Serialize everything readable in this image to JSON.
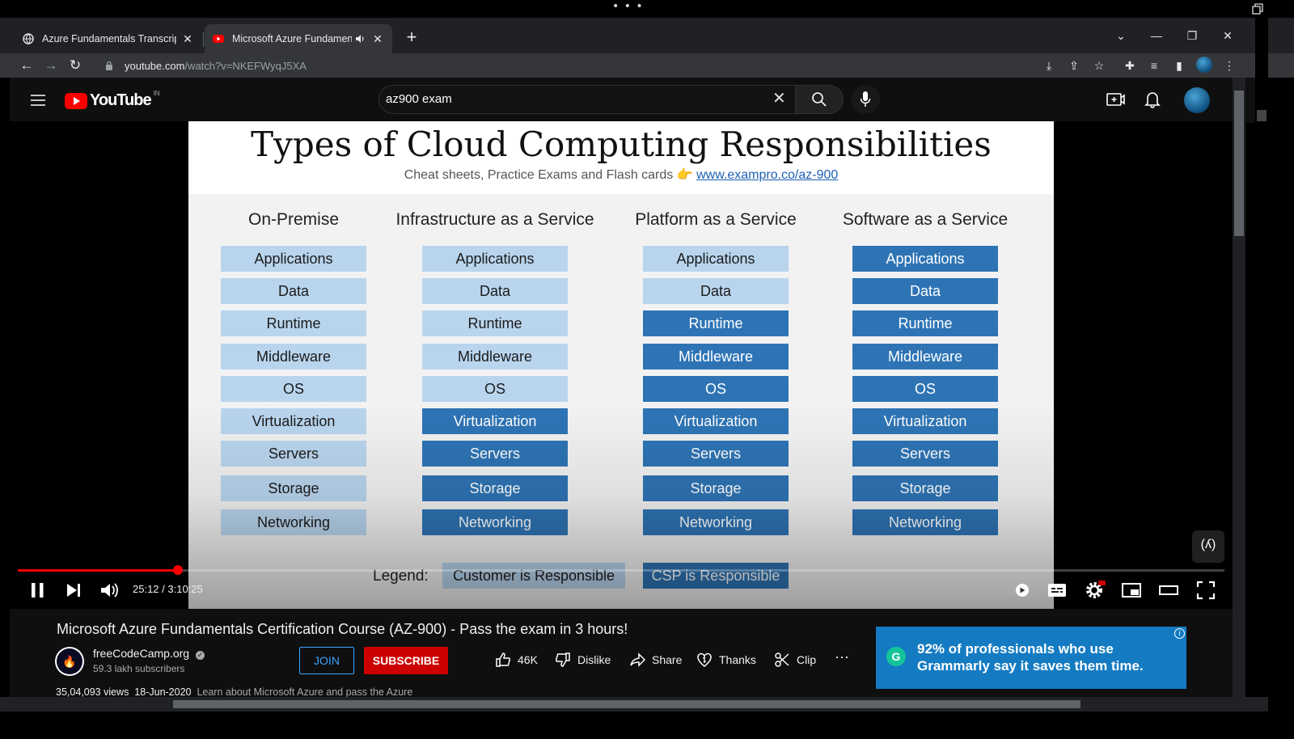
{
  "browser": {
    "tabs": [
      {
        "title": "Azure Fundamentals Transcript",
        "icon": "globe-icon"
      },
      {
        "title": "Microsoft Azure Fundamentals",
        "icon": "youtube-icon",
        "audio": true
      }
    ],
    "url_host": "youtube.com",
    "url_path": "/watch?v=NKEFWyqJ5XA"
  },
  "youtube": {
    "logo": "YouTube",
    "country": "IN",
    "search_value": "az900 exam"
  },
  "slide": {
    "title": "Types of Cloud Computing Responsibilities",
    "subtitle": "Cheat sheets, Practice Exams and Flash cards 👉",
    "link": "www.exampro.co/az-900",
    "columns": [
      {
        "heading": "On-Premise"
      },
      {
        "heading": "Infrastructure as a Service"
      },
      {
        "heading": "Platform as a Service"
      },
      {
        "heading": "Software as a Service"
      }
    ],
    "rows": [
      "Applications",
      "Data",
      "Runtime",
      "Middleware",
      "OS",
      "Virtualization",
      "Servers",
      "Storage",
      "Networking"
    ],
    "legend_label": "Legend:",
    "legend_customer": "Customer is Responsible",
    "legend_csp": "CSP is Responsible"
  },
  "player": {
    "time": "25:12 / 3:10:25",
    "progress": 0.1324
  },
  "video": {
    "title": "Microsoft Azure Fundamentals Certification Course (AZ-900) - Pass the exam in 3 hours!",
    "channel": "freeCodeCamp.org",
    "subscribers": "59.3 lakh subscribers",
    "join": "JOIN",
    "subscribe": "SUBSCRIBE",
    "likes": "46K",
    "dislike": "Dislike",
    "share": "Share",
    "thanks": "Thanks",
    "clip": "Clip",
    "views": "35,04,093 views",
    "date": "18-Jun-2020",
    "desc_start": "Learn about Microsoft Azure and pass the Azure"
  },
  "ad": {
    "text_line1": "92% of professionals who use",
    "text_line2": "Grammarly say it saves them time.",
    "brand_letter": "G"
  },
  "colors": {
    "customer": "#b9d5ee",
    "csp": "#2e74b5",
    "accent_red": "#ff0000"
  }
}
